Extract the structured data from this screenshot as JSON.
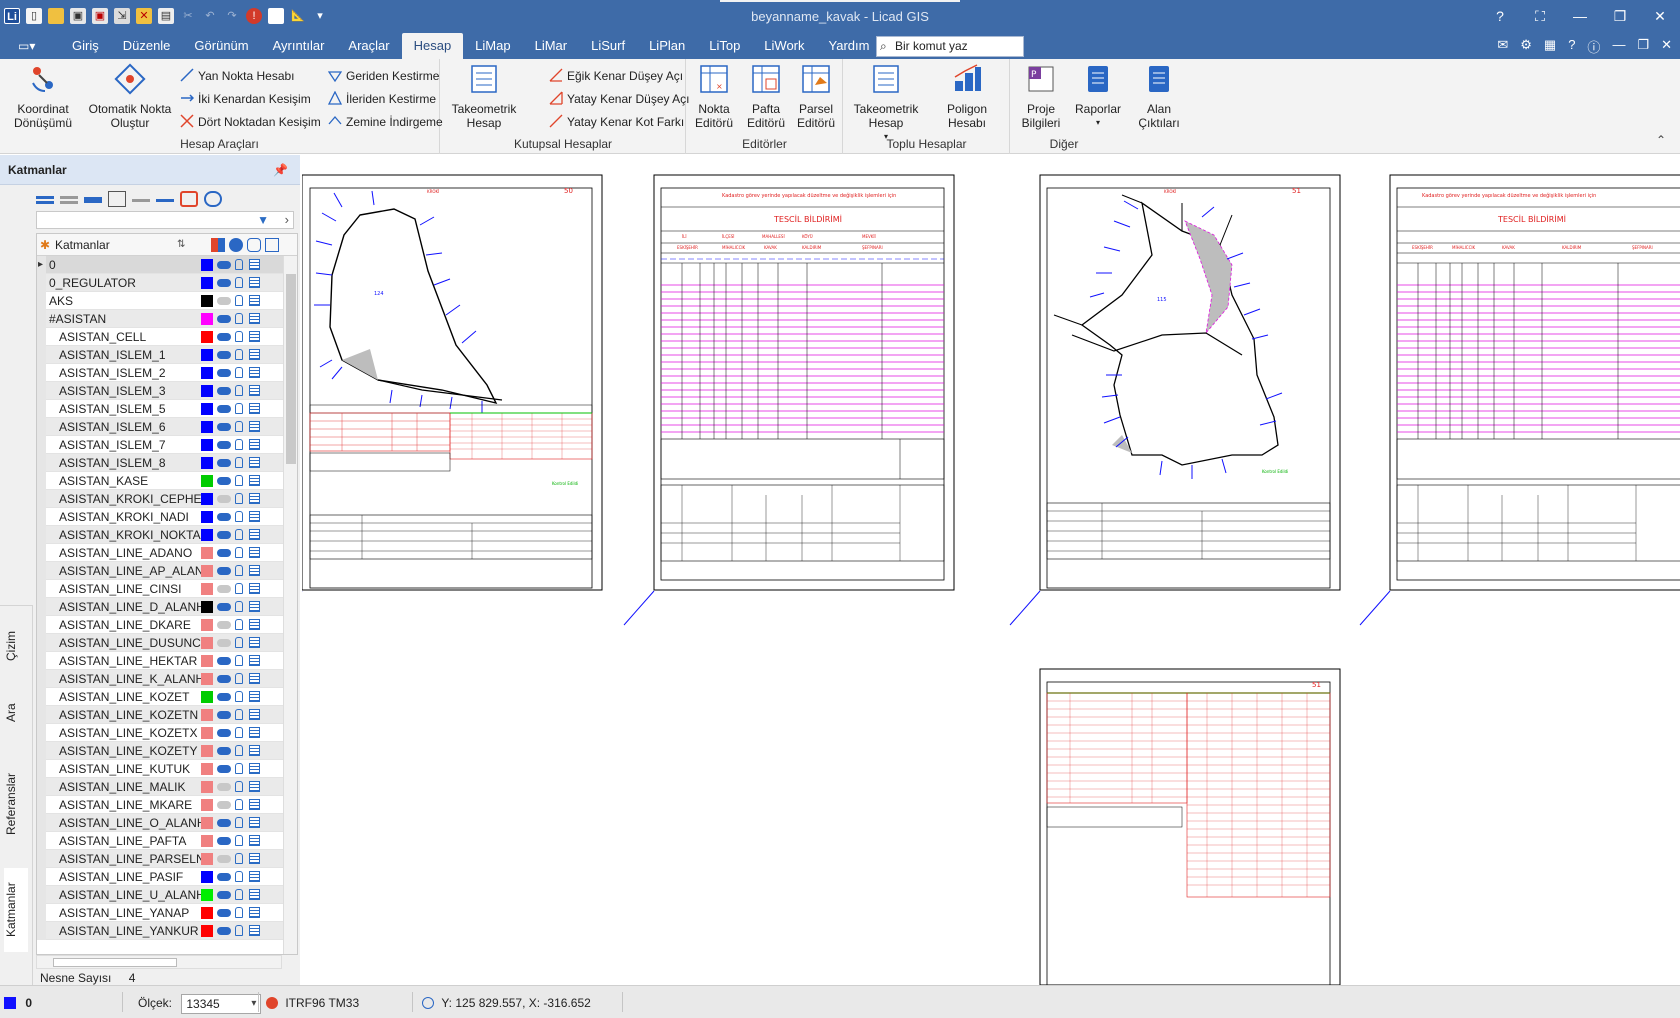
{
  "window": {
    "title": "beyanname_kavak  -  Licad GIS",
    "controls": [
      "?",
      "⛶",
      "—",
      "❐",
      "✕"
    ]
  },
  "ribbon_tabs": [
    "Giriş",
    "Düzenle",
    "Görünüm",
    "Ayrıntılar",
    "Araçlar",
    "Hesap",
    "LiMap",
    "LiMar",
    "LiSurf",
    "LiPlan",
    "LiTop",
    "LiWork",
    "Yardım"
  ],
  "active_tab": "Hesap",
  "command_search": {
    "placeholder": "Bir komut yaz"
  },
  "ribbon": {
    "hesap_araclari": {
      "label": "Hesap Araçları",
      "koordinat": "Koordinat Dönüşümü",
      "otomatik": "Otomatik Nokta Oluştur",
      "yan_nokta": "Yan Nokta Hesabı",
      "iki_kenar": "İki Kenardan Kesişim",
      "dort_nokta": "Dört Noktadan Kesişim",
      "geriden": "Geriden Kestirme",
      "ileriden": "İleriden Kestirme",
      "zemine": "Zemine İndirgeme"
    },
    "kutupsal": {
      "label": "Kutupsal Hesaplar",
      "takeo": "Takeometrik Hesap",
      "egik": "Eğik Kenar Düşey Açı",
      "yatay_dusey": "Yatay Kenar Düşey Açı",
      "yatay_kot": "Yatay Kenar Kot Farkı"
    },
    "editorler": {
      "label": "Editörler",
      "nokta": "Nokta Editörü",
      "pafta": "Pafta Editörü",
      "parsel": "Parsel Editörü"
    },
    "toplu": {
      "label": "Toplu Hesaplar",
      "takeo": "Takeometrik Hesap",
      "poligon": "Poligon Hesabı"
    },
    "diger": {
      "label": "Diğer",
      "proje": "Proje Bilgileri",
      "raporlar": "Raporlar",
      "alan": "Alan Çıktıları"
    }
  },
  "layers_panel": {
    "title": "Katmanlar",
    "column_header": "Katmanlar",
    "side_tabs": [
      "Çizim",
      "Ara",
      "Referanslar",
      "Katmanlar"
    ],
    "layers": [
      {
        "name": "0",
        "color": "#0000ff",
        "visible": true,
        "child": false
      },
      {
        "name": "0_REGULATOR",
        "color": "#0000ff",
        "visible": true,
        "child": false
      },
      {
        "name": "AKS",
        "color": "#000000",
        "visible": false,
        "child": false
      },
      {
        "name": "#ASISTAN",
        "color": "#ff00ff",
        "visible": true,
        "child": false
      },
      {
        "name": "ASISTAN_CELL",
        "color": "#ff0000",
        "visible": true,
        "child": true
      },
      {
        "name": "ASISTAN_ISLEM_1",
        "color": "#0000ff",
        "visible": true,
        "child": true
      },
      {
        "name": "ASISTAN_ISLEM_2",
        "color": "#0000ff",
        "visible": true,
        "child": true
      },
      {
        "name": "ASISTAN_ISLEM_3",
        "color": "#0000ff",
        "visible": true,
        "child": true
      },
      {
        "name": "ASISTAN_ISLEM_5",
        "color": "#0000ff",
        "visible": true,
        "child": true
      },
      {
        "name": "ASISTAN_ISLEM_6",
        "color": "#0000ff",
        "visible": true,
        "child": true
      },
      {
        "name": "ASISTAN_ISLEM_7",
        "color": "#0000ff",
        "visible": true,
        "child": true
      },
      {
        "name": "ASISTAN_ISLEM_8",
        "color": "#0000ff",
        "visible": true,
        "child": true
      },
      {
        "name": "ASISTAN_KASE",
        "color": "#00cc00",
        "visible": true,
        "child": true
      },
      {
        "name": "ASISTAN_KROKI_CEPHE",
        "color": "#0000ff",
        "visible": false,
        "child": true
      },
      {
        "name": "ASISTAN_KROKI_NADI",
        "color": "#0000ff",
        "visible": true,
        "child": true
      },
      {
        "name": "ASISTAN_KROKI_NOKTA",
        "color": "#0000ff",
        "visible": true,
        "child": true
      },
      {
        "name": "ASISTAN_LINE_ADANO",
        "color": "#f08080",
        "visible": true,
        "child": true
      },
      {
        "name": "ASISTAN_LINE_AP_ALAN",
        "color": "#f08080",
        "visible": true,
        "child": true
      },
      {
        "name": "ASISTAN_LINE_CINSI",
        "color": "#f08080",
        "visible": false,
        "child": true
      },
      {
        "name": "ASISTAN_LINE_D_ALANH",
        "color": "#000000",
        "visible": true,
        "child": true
      },
      {
        "name": "ASISTAN_LINE_DKARE",
        "color": "#f08080",
        "visible": false,
        "child": true
      },
      {
        "name": "ASISTAN_LINE_DUSUNCE",
        "color": "#f08080",
        "visible": false,
        "child": true
      },
      {
        "name": "ASISTAN_LINE_HEKTAR",
        "color": "#f08080",
        "visible": true,
        "child": true
      },
      {
        "name": "ASISTAN_LINE_K_ALANH",
        "color": "#f08080",
        "visible": true,
        "child": true
      },
      {
        "name": "ASISTAN_LINE_KOZET",
        "color": "#00cc00",
        "visible": true,
        "child": true
      },
      {
        "name": "ASISTAN_LINE_KOZETN",
        "color": "#f08080",
        "visible": true,
        "child": true
      },
      {
        "name": "ASISTAN_LINE_KOZETX",
        "color": "#f08080",
        "visible": true,
        "child": true
      },
      {
        "name": "ASISTAN_LINE_KOZETY",
        "color": "#f08080",
        "visible": true,
        "child": true
      },
      {
        "name": "ASISTAN_LINE_KUTUK",
        "color": "#f08080",
        "visible": true,
        "child": true
      },
      {
        "name": "ASISTAN_LINE_MALIK",
        "color": "#f08080",
        "visible": false,
        "child": true
      },
      {
        "name": "ASISTAN_LINE_MKARE",
        "color": "#f08080",
        "visible": false,
        "child": true
      },
      {
        "name": "ASISTAN_LINE_O_ALANH",
        "color": "#f08080",
        "visible": true,
        "child": true
      },
      {
        "name": "ASISTAN_LINE_PAFTA",
        "color": "#f08080",
        "visible": true,
        "child": true
      },
      {
        "name": "ASISTAN_LINE_PARSELN",
        "color": "#f08080",
        "visible": false,
        "child": true
      },
      {
        "name": "ASISTAN_LINE_PASIF",
        "color": "#0000ff",
        "visible": true,
        "child": true
      },
      {
        "name": "ASISTAN_LINE_U_ALANH",
        "color": "#00ee00",
        "visible": true,
        "child": true
      },
      {
        "name": "ASISTAN_LINE_YANAP",
        "color": "#ff0000",
        "visible": true,
        "child": true
      },
      {
        "name": "ASISTAN_LINE_YANKUR",
        "color": "#ff0000",
        "visible": true,
        "child": true
      }
    ],
    "object_count_label": "Nesne Sayısı",
    "object_count": "4"
  },
  "drawing": {
    "sheet_numbers": [
      "50",
      "51",
      "51"
    ],
    "form_title": "TESCİL BİLDİRİMİ",
    "form_header": "Kadastro görev yerinde yapılacak düzeltme ve değişiklik işlemleri için",
    "form_fields": [
      "İLİ",
      "İLÇESİ",
      "MAHALLESİ",
      "KÖYÜ",
      "MEVKİİ"
    ],
    "form_values": [
      "ESKİŞEHİR",
      "MİHALICCIK",
      "KAVAK",
      "KALDIRIM",
      "ŞEFPINARI"
    ]
  },
  "status": {
    "layer": "0",
    "scale_label": "Ölçek:",
    "scale": "13345",
    "crs": "ITRF96 TM33",
    "coords": "Y: 125 829.557, X: -316.652"
  }
}
